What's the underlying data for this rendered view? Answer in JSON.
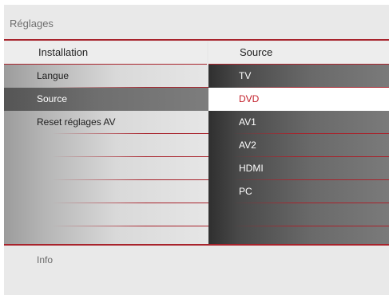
{
  "screen": {
    "title": "Réglages"
  },
  "columns": {
    "left_header": "Installation",
    "right_header": "Source"
  },
  "menu": {
    "items": [
      {
        "label": "Langue"
      },
      {
        "label": "Source"
      },
      {
        "label": "Reset réglages AV"
      }
    ],
    "selected": "Source"
  },
  "submenu": {
    "items": [
      {
        "label": "TV"
      },
      {
        "label": "DVD"
      },
      {
        "label": "AV1"
      },
      {
        "label": "AV2"
      },
      {
        "label": "HDMI"
      },
      {
        "label": "PC"
      }
    ],
    "selected": "DVD"
  },
  "footer": {
    "info_label": "Info"
  },
  "colors": {
    "accent": "#a8232c",
    "selected_text": "#c3202b"
  }
}
